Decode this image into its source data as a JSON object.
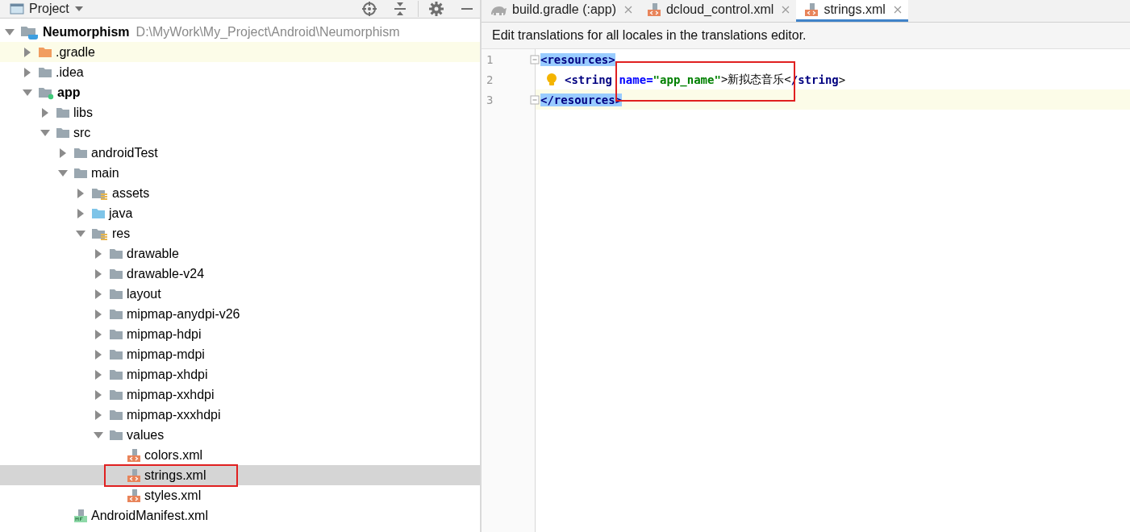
{
  "project_panel": {
    "title": "Project",
    "tree": [
      {
        "label": "Neumorphism",
        "path": "D:\\MyWork\\My_Project\\Android\\Neumorphism",
        "kind": "project",
        "bold": true,
        "expanded": true,
        "selected": false,
        "children": [
          {
            "label": ".gradle",
            "kind": "excluded",
            "expanded": false,
            "selected": false,
            "current": true
          },
          {
            "label": ".idea",
            "kind": "folder",
            "expanded": false,
            "selected": false
          },
          {
            "label": "app",
            "kind": "module",
            "bold": true,
            "expanded": true,
            "selected": false,
            "children": [
              {
                "label": "libs",
                "kind": "folder",
                "expanded": false,
                "selected": false
              },
              {
                "label": "src",
                "kind": "folder",
                "expanded": true,
                "selected": false,
                "children": [
                  {
                    "label": "androidTest",
                    "kind": "folder",
                    "expanded": false,
                    "selected": false
                  },
                  {
                    "label": "main",
                    "kind": "folder",
                    "expanded": true,
                    "selected": false,
                    "children": [
                      {
                        "label": "assets",
                        "kind": "resources",
                        "expanded": false,
                        "selected": false
                      },
                      {
                        "label": "java",
                        "kind": "sources",
                        "expanded": false,
                        "selected": false
                      },
                      {
                        "label": "res",
                        "kind": "resources",
                        "expanded": true,
                        "selected": false,
                        "children": [
                          {
                            "label": "drawable",
                            "kind": "folder",
                            "expanded": false,
                            "selected": false
                          },
                          {
                            "label": "drawable-v24",
                            "kind": "folder",
                            "expanded": false,
                            "selected": false
                          },
                          {
                            "label": "layout",
                            "kind": "folder",
                            "expanded": false,
                            "selected": false
                          },
                          {
                            "label": "mipmap-anydpi-v26",
                            "kind": "folder",
                            "expanded": false,
                            "selected": false
                          },
                          {
                            "label": "mipmap-hdpi",
                            "kind": "folder",
                            "expanded": false,
                            "selected": false
                          },
                          {
                            "label": "mipmap-mdpi",
                            "kind": "folder",
                            "expanded": false,
                            "selected": false
                          },
                          {
                            "label": "mipmap-xhdpi",
                            "kind": "folder",
                            "expanded": false,
                            "selected": false
                          },
                          {
                            "label": "mipmap-xxhdpi",
                            "kind": "folder",
                            "expanded": false,
                            "selected": false
                          },
                          {
                            "label": "mipmap-xxxhdpi",
                            "kind": "folder",
                            "expanded": false,
                            "selected": false
                          },
                          {
                            "label": "values",
                            "kind": "folder",
                            "expanded": true,
                            "selected": false,
                            "children": [
                              {
                                "label": "colors.xml",
                                "kind": "xml",
                                "selected": false
                              },
                              {
                                "label": "strings.xml",
                                "kind": "xml",
                                "selected": true,
                                "annotated": true
                              },
                              {
                                "label": "styles.xml",
                                "kind": "xml",
                                "selected": false
                              }
                            ]
                          }
                        ]
                      }
                    ]
                  },
                  {
                    "label": "AndroidManifest.xml",
                    "kind": "manifest",
                    "selected": false
                  }
                ]
              }
            ]
          }
        ]
      }
    ]
  },
  "editor": {
    "tabs": [
      {
        "label": "build.gradle (:app)",
        "kind": "gradle",
        "selected": false
      },
      {
        "label": "dcloud_control.xml",
        "kind": "xml",
        "selected": false
      },
      {
        "label": "strings.xml",
        "kind": "xml",
        "selected": true
      }
    ],
    "notice": "Edit translations for all locales in the translations editor.",
    "lines": [
      {
        "number": "1",
        "current": false,
        "bulb": false,
        "tokens": [
          {
            "text": "<resources>",
            "kind": "tag",
            "matched": true
          }
        ]
      },
      {
        "number": "2",
        "current": false,
        "bulb": true,
        "tokens": [
          {
            "text": "<string ",
            "kind": "tag"
          },
          {
            "text": "name=",
            "kind": "attr",
            "annotated": true
          },
          {
            "text": "\"app_name\"",
            "kind": "value",
            "annotated": true
          },
          {
            "text": ">新拟态音乐<",
            "kind": "text",
            "annotated": true
          },
          {
            "text": "/string",
            "kind": "tag"
          },
          {
            "text": ">",
            "kind": "text"
          }
        ]
      },
      {
        "number": "3",
        "current": true,
        "bulb": false,
        "tokens": [
          {
            "text": "</resources>",
            "kind": "tag",
            "matched": true
          }
        ]
      }
    ]
  }
}
